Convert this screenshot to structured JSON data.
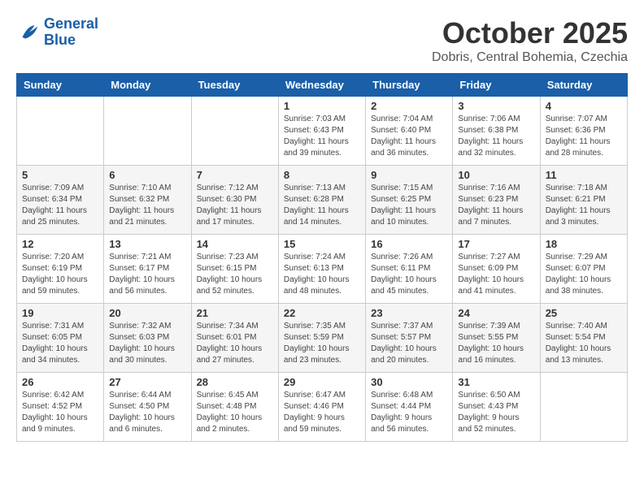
{
  "header": {
    "logo_line1": "General",
    "logo_line2": "Blue",
    "month": "October 2025",
    "location": "Dobris, Central Bohemia, Czechia"
  },
  "weekdays": [
    "Sunday",
    "Monday",
    "Tuesday",
    "Wednesday",
    "Thursday",
    "Friday",
    "Saturday"
  ],
  "weeks": [
    [
      {
        "day": "",
        "info": ""
      },
      {
        "day": "",
        "info": ""
      },
      {
        "day": "",
        "info": ""
      },
      {
        "day": "1",
        "info": "Sunrise: 7:03 AM\nSunset: 6:43 PM\nDaylight: 11 hours\nand 39 minutes."
      },
      {
        "day": "2",
        "info": "Sunrise: 7:04 AM\nSunset: 6:40 PM\nDaylight: 11 hours\nand 36 minutes."
      },
      {
        "day": "3",
        "info": "Sunrise: 7:06 AM\nSunset: 6:38 PM\nDaylight: 11 hours\nand 32 minutes."
      },
      {
        "day": "4",
        "info": "Sunrise: 7:07 AM\nSunset: 6:36 PM\nDaylight: 11 hours\nand 28 minutes."
      }
    ],
    [
      {
        "day": "5",
        "info": "Sunrise: 7:09 AM\nSunset: 6:34 PM\nDaylight: 11 hours\nand 25 minutes."
      },
      {
        "day": "6",
        "info": "Sunrise: 7:10 AM\nSunset: 6:32 PM\nDaylight: 11 hours\nand 21 minutes."
      },
      {
        "day": "7",
        "info": "Sunrise: 7:12 AM\nSunset: 6:30 PM\nDaylight: 11 hours\nand 17 minutes."
      },
      {
        "day": "8",
        "info": "Sunrise: 7:13 AM\nSunset: 6:28 PM\nDaylight: 11 hours\nand 14 minutes."
      },
      {
        "day": "9",
        "info": "Sunrise: 7:15 AM\nSunset: 6:25 PM\nDaylight: 11 hours\nand 10 minutes."
      },
      {
        "day": "10",
        "info": "Sunrise: 7:16 AM\nSunset: 6:23 PM\nDaylight: 11 hours\nand 7 minutes."
      },
      {
        "day": "11",
        "info": "Sunrise: 7:18 AM\nSunset: 6:21 PM\nDaylight: 11 hours\nand 3 minutes."
      }
    ],
    [
      {
        "day": "12",
        "info": "Sunrise: 7:20 AM\nSunset: 6:19 PM\nDaylight: 10 hours\nand 59 minutes."
      },
      {
        "day": "13",
        "info": "Sunrise: 7:21 AM\nSunset: 6:17 PM\nDaylight: 10 hours\nand 56 minutes."
      },
      {
        "day": "14",
        "info": "Sunrise: 7:23 AM\nSunset: 6:15 PM\nDaylight: 10 hours\nand 52 minutes."
      },
      {
        "day": "15",
        "info": "Sunrise: 7:24 AM\nSunset: 6:13 PM\nDaylight: 10 hours\nand 48 minutes."
      },
      {
        "day": "16",
        "info": "Sunrise: 7:26 AM\nSunset: 6:11 PM\nDaylight: 10 hours\nand 45 minutes."
      },
      {
        "day": "17",
        "info": "Sunrise: 7:27 AM\nSunset: 6:09 PM\nDaylight: 10 hours\nand 41 minutes."
      },
      {
        "day": "18",
        "info": "Sunrise: 7:29 AM\nSunset: 6:07 PM\nDaylight: 10 hours\nand 38 minutes."
      }
    ],
    [
      {
        "day": "19",
        "info": "Sunrise: 7:31 AM\nSunset: 6:05 PM\nDaylight: 10 hours\nand 34 minutes."
      },
      {
        "day": "20",
        "info": "Sunrise: 7:32 AM\nSunset: 6:03 PM\nDaylight: 10 hours\nand 30 minutes."
      },
      {
        "day": "21",
        "info": "Sunrise: 7:34 AM\nSunset: 6:01 PM\nDaylight: 10 hours\nand 27 minutes."
      },
      {
        "day": "22",
        "info": "Sunrise: 7:35 AM\nSunset: 5:59 PM\nDaylight: 10 hours\nand 23 minutes."
      },
      {
        "day": "23",
        "info": "Sunrise: 7:37 AM\nSunset: 5:57 PM\nDaylight: 10 hours\nand 20 minutes."
      },
      {
        "day": "24",
        "info": "Sunrise: 7:39 AM\nSunset: 5:55 PM\nDaylight: 10 hours\nand 16 minutes."
      },
      {
        "day": "25",
        "info": "Sunrise: 7:40 AM\nSunset: 5:54 PM\nDaylight: 10 hours\nand 13 minutes."
      }
    ],
    [
      {
        "day": "26",
        "info": "Sunrise: 6:42 AM\nSunset: 4:52 PM\nDaylight: 10 hours\nand 9 minutes."
      },
      {
        "day": "27",
        "info": "Sunrise: 6:44 AM\nSunset: 4:50 PM\nDaylight: 10 hours\nand 6 minutes."
      },
      {
        "day": "28",
        "info": "Sunrise: 6:45 AM\nSunset: 4:48 PM\nDaylight: 10 hours\nand 2 minutes."
      },
      {
        "day": "29",
        "info": "Sunrise: 6:47 AM\nSunset: 4:46 PM\nDaylight: 9 hours\nand 59 minutes."
      },
      {
        "day": "30",
        "info": "Sunrise: 6:48 AM\nSunset: 4:44 PM\nDaylight: 9 hours\nand 56 minutes."
      },
      {
        "day": "31",
        "info": "Sunrise: 6:50 AM\nSunset: 4:43 PM\nDaylight: 9 hours\nand 52 minutes."
      },
      {
        "day": "",
        "info": ""
      }
    ]
  ]
}
